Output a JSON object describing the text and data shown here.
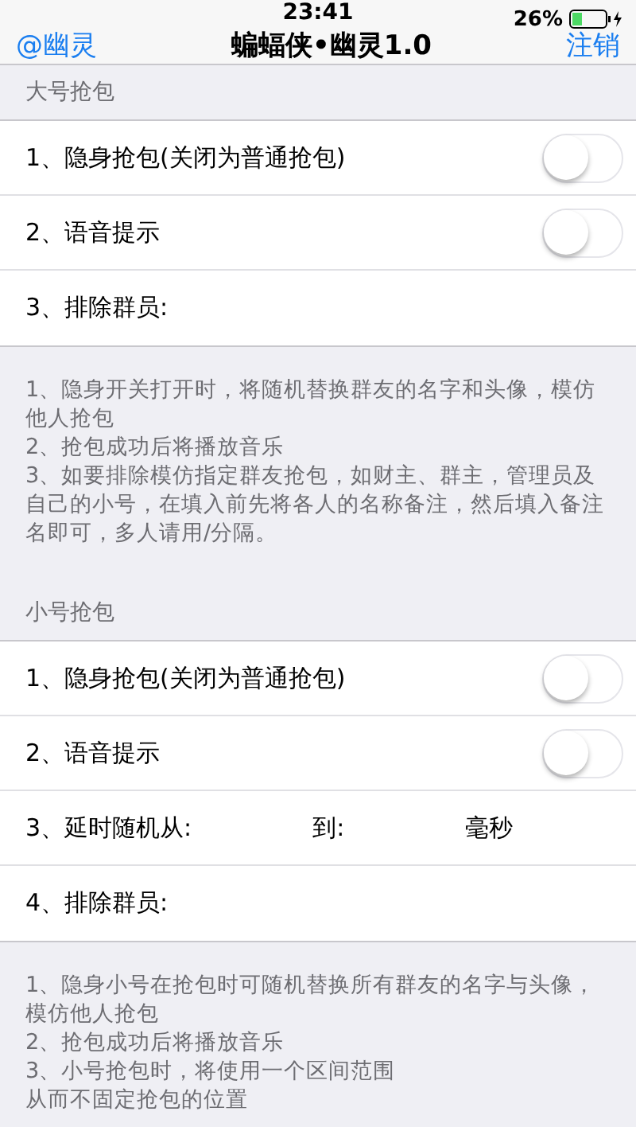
{
  "status_bar": {
    "time": "23:41",
    "battery": "26%"
  },
  "nav": {
    "left": "@幽灵",
    "title": "蝙蝠侠•幽灵1.0",
    "right": "注销"
  },
  "sections": [
    {
      "header": "大号抢包",
      "rows": [
        {
          "kind": "switch",
          "label": "1、隐身抢包(关闭为普通抢包)",
          "on": false
        },
        {
          "kind": "switch",
          "label": "2、语音提示",
          "on": false
        },
        {
          "kind": "field",
          "label": "3、排除群员:"
        }
      ],
      "notes": [
        "1、隐身开关打开时，将随机替换群友的名字和头像，模仿他人抢包",
        "2、抢包成功后将播放音乐",
        "3、如要排除模仿指定群友抢包，如财主、群主，管理员及自己的小号，在填入前先将各人的名称备注，然后填入备注名即可，多人请用/分隔。"
      ]
    },
    {
      "header": "小号抢包",
      "rows": [
        {
          "kind": "switch",
          "label": "1、隐身抢包(关闭为普通抢包)",
          "on": false
        },
        {
          "kind": "switch",
          "label": "2、语音提示",
          "on": false
        },
        {
          "kind": "range",
          "label": "3、延时随机从:",
          "to": "到:",
          "unit": "毫秒"
        },
        {
          "kind": "field",
          "label": "4、排除群员:"
        }
      ],
      "notes": [
        "1、隐身小号在抢包时可随机替换所有群友的名字与头像，模仿他人抢包",
        "2、抢包成功后将播放音乐",
        "3、小号抢包时，将使用一个区间范围",
        "从而不固定抢包的位置"
      ]
    }
  ]
}
